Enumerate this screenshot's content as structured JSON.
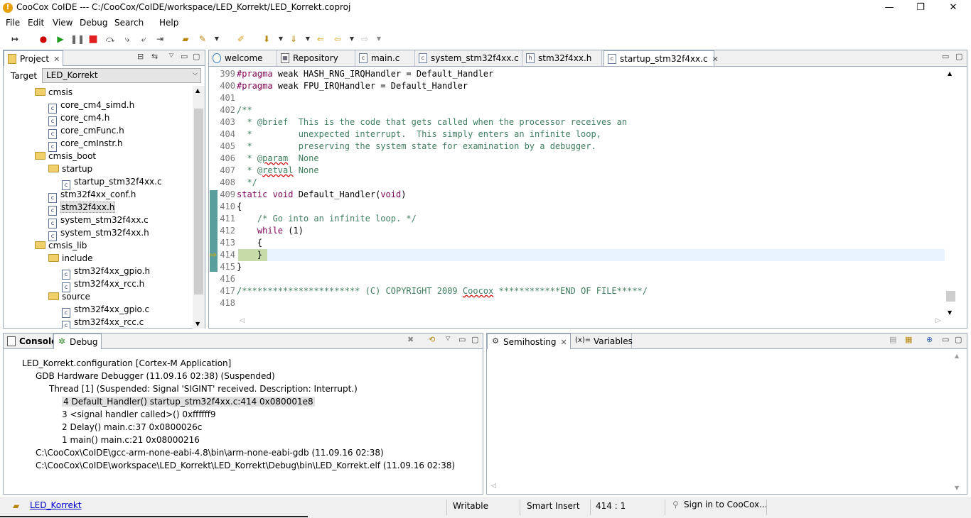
{
  "window": {
    "title": "CooCox CoIDE --- C:/CooCox/CoIDE/workspace/LED_Korrekt/LED_Korrekt.coproj",
    "minimize": "—",
    "maximize": "❐",
    "close": "✕"
  },
  "menu": [
    "File",
    "Edit",
    "View",
    "Debug",
    "Search",
    "Help"
  ],
  "project_panel": {
    "tab_label": "Project",
    "target_label": "Target",
    "target_value": "LED_Korrekt",
    "tree": [
      {
        "label": "cmsis",
        "type": "folder",
        "level": 0
      },
      {
        "label": "core_cm4_simd.h",
        "type": "file",
        "level": 1
      },
      {
        "label": "core_cm4.h",
        "type": "file",
        "level": 1
      },
      {
        "label": "core_cmFunc.h",
        "type": "file",
        "level": 1
      },
      {
        "label": "core_cmInstr.h",
        "type": "file",
        "level": 1
      },
      {
        "label": "cmsis_boot",
        "type": "folder",
        "level": 0
      },
      {
        "label": "startup",
        "type": "folder",
        "level": 1
      },
      {
        "label": "startup_stm32f4xx.c",
        "type": "file",
        "level": 2
      },
      {
        "label": "stm32f4xx_conf.h",
        "type": "file",
        "level": 1
      },
      {
        "label": "stm32f4xx.h",
        "type": "file",
        "level": 1,
        "selected": true
      },
      {
        "label": "system_stm32f4xx.c",
        "type": "file",
        "level": 1
      },
      {
        "label": "system_stm32f4xx.h",
        "type": "file",
        "level": 1
      },
      {
        "label": "cmsis_lib",
        "type": "folder",
        "level": 0
      },
      {
        "label": "include",
        "type": "folder",
        "level": 1
      },
      {
        "label": "stm32f4xx_gpio.h",
        "type": "file",
        "level": 2
      },
      {
        "label": "stm32f4xx_rcc.h",
        "type": "file",
        "level": 2
      },
      {
        "label": "source",
        "type": "folder",
        "level": 1
      },
      {
        "label": "stm32f4xx_gpio.c",
        "type": "file",
        "level": 2
      },
      {
        "label": "stm32f4xx_rcc.c",
        "type": "file",
        "level": 2
      }
    ]
  },
  "editor": {
    "tabs": [
      {
        "label": "welcome",
        "icon": "globe-icon"
      },
      {
        "label": "Repository",
        "icon": "grid-icon"
      },
      {
        "label": "main.c",
        "icon": "c-file-icon"
      },
      {
        "label": "system_stm32f4xx.c",
        "icon": "c-file-icon"
      },
      {
        "label": "stm32f4xx.h",
        "icon": "h-file-icon"
      },
      {
        "label": "startup_stm32f4xx.c",
        "icon": "c-file-icon",
        "active": true
      }
    ],
    "lines": [
      {
        "n": "399",
        "html": "<span class=\"kw\">#pragma</span> weak HASH_RNG_IRQHandler = Default_Handler"
      },
      {
        "n": "400",
        "html": "<span class=\"kw\">#pragma</span> weak FPU_IRQHandler = Default_Handler"
      },
      {
        "n": "401",
        "html": ""
      },
      {
        "n": "402",
        "html": "<span class=\"cm\">/**</span>"
      },
      {
        "n": "403",
        "html": "<span class=\"cm\">  * @brief  This is the code that gets called when the processor receives an</span>"
      },
      {
        "n": "404",
        "html": "<span class=\"cm\">  *         unexpected interrupt.  This simply enters an infinite loop,</span>"
      },
      {
        "n": "405",
        "html": "<span class=\"cm\">  *         preserving the system state for examination by a debugger.</span>"
      },
      {
        "n": "406",
        "html": "<span class=\"cm\">  * @<span class=\"und\">param</span>  None</span>"
      },
      {
        "n": "407",
        "html": "<span class=\"cm\">  * @<span class=\"und\">retval</span> None</span>"
      },
      {
        "n": "408",
        "html": "<span class=\"cm\">  */</span>"
      },
      {
        "n": "409",
        "html": "<span class=\"kwb\">static void</span> Default_Handler(<span class=\"kwb\">void</span>)"
      },
      {
        "n": "410",
        "html": "{"
      },
      {
        "n": "411",
        "html": "    <span class=\"cm\">/* Go into an infinite loop. */</span>"
      },
      {
        "n": "412",
        "html": "    <span class=\"kwb\">while</span> (1)"
      },
      {
        "n": "413",
        "html": "    {"
      },
      {
        "n": "414",
        "html": "    }"
      },
      {
        "n": "415",
        "html": "}"
      },
      {
        "n": "416",
        "html": ""
      },
      {
        "n": "417",
        "html": "<span class=\"cm\">/*********************** (C) COPYRIGHT 2009 <span class=\"und\">Coocox</span> ************END OF FILE*****/</span>"
      },
      {
        "n": "418",
        "html": ""
      }
    ]
  },
  "console_panel": {
    "tabs": [
      {
        "label": "Console"
      },
      {
        "label": "Debug",
        "active": true
      }
    ],
    "lines": [
      {
        "text": "LED_Korrekt.configuration [Cortex-M Application]",
        "indent": 1
      },
      {
        "text": "GDB Hardware Debugger (11.09.16 02:38) (Suspended)",
        "indent": 2
      },
      {
        "text": "Thread [1] (Suspended: Signal 'SIGINT' received. Description: Interrupt.)",
        "indent": 3
      },
      {
        "text": "4 Default_Handler() startup_stm32f4xx.c:414 0x080001e8",
        "indent": 4,
        "selected": true
      },
      {
        "text": "3 <signal handler called>()  0xffffff9",
        "indent": 4
      },
      {
        "text": "2 Delay() main.c:37 0x0800026c",
        "indent": 4
      },
      {
        "text": "1 main() main.c:21 0x08000216",
        "indent": 4
      },
      {
        "text": "C:\\CooCox\\CoIDE\\gcc-arm-none-eabi-4.8\\bin\\arm-none-eabi-gdb (11.09.16 02:38)",
        "indent": 2
      },
      {
        "text": "C:\\CooCox\\CoIDE\\workspace\\LED_Korrekt\\LED_Korrekt\\Debug\\bin\\LED_Korrekt.elf (11.09.16 02:38)",
        "indent": 2
      }
    ]
  },
  "semihosting_panel": {
    "tabs": [
      {
        "label": "Semihosting",
        "active": true
      },
      {
        "label": "Variables"
      }
    ]
  },
  "statusbar": {
    "project_link": "LED_Korrekt",
    "mode": "Writable",
    "insert": "Smart Insert",
    "position": "414 : 1",
    "signin": "Sign in to CooCox..."
  }
}
